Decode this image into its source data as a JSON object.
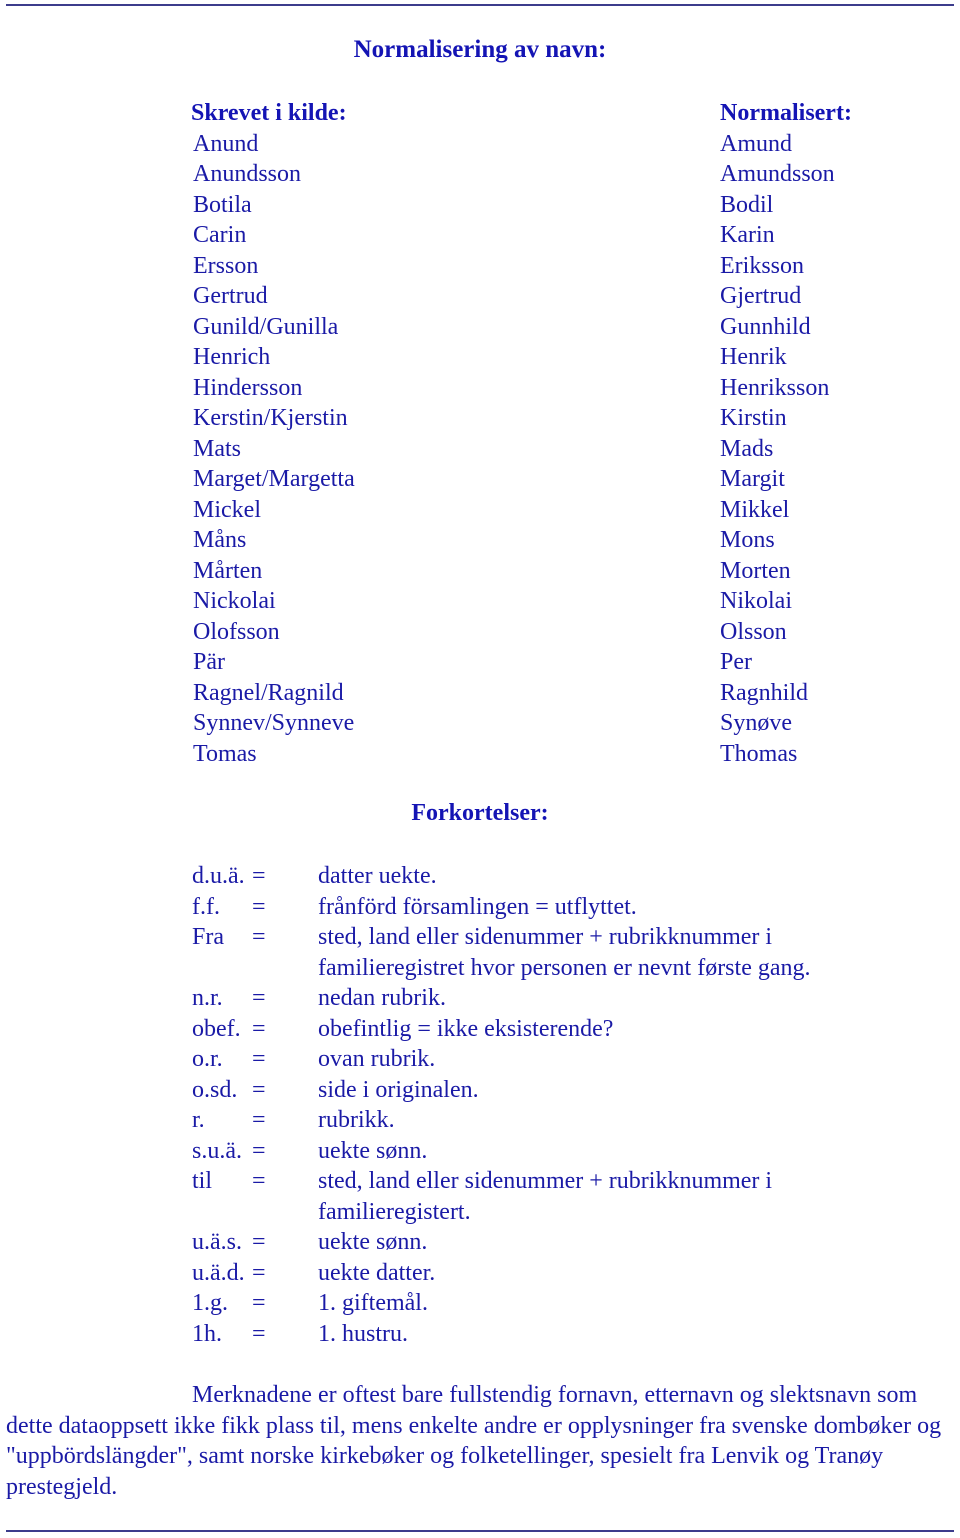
{
  "title": "Normalisering av navn:",
  "names": {
    "source_header": "Skrevet i kilde:",
    "normalized_header": "Normalisert:",
    "source": [
      "Anund",
      "Anundsson",
      "Botila",
      "Carin",
      "Ersson",
      "Gertrud",
      "Gunild/Gunilla",
      "Henrich",
      "Hindersson",
      "Kerstin/Kjerstin",
      "Mats",
      "Marget/Margetta",
      "Mickel",
      "Måns",
      "Mårten",
      "Nickolai",
      "Olofsson",
      "Pär",
      "Ragnel/Ragnild",
      "Synnev/Synneve",
      "Tomas"
    ],
    "normalized": [
      "Amund",
      "Amundsson",
      "Bodil",
      "Karin",
      "Eriksson",
      "Gjertrud",
      "Gunnhild",
      "Henrik",
      "Henriksson",
      "Kirstin",
      "Mads",
      "Margit",
      "Mikkel",
      "Mons",
      "Morten",
      "Nikolai",
      "Olsson",
      "Per",
      "Ragnhild",
      "Synøve",
      "Thomas"
    ]
  },
  "abbreviations": {
    "title": "Forkortelser:",
    "items": [
      {
        "key": "d.u.ä.",
        "eq": "=",
        "def": "datter uekte."
      },
      {
        "key": "f.f.",
        "eq": "=",
        "def": "frånförd församlingen = utflyttet."
      },
      {
        "key": "Fra",
        "eq": "=",
        "def": "sted, land eller sidenummer + rubrikknummer i familieregistret hvor personen er nevnt første gang."
      },
      {
        "key": "n.r.",
        "eq": "=",
        "def": "nedan rubrik."
      },
      {
        "key": "obef.",
        "eq": "=",
        "def": "obefintlig = ikke eksisterende?"
      },
      {
        "key": "o.r.",
        "eq": "=",
        "def": "ovan rubrik."
      },
      {
        "key": "o.sd.",
        "eq": "=",
        "def": "side i originalen."
      },
      {
        "key": "r.",
        "eq": "=",
        "def": "rubrikk."
      },
      {
        "key": "s.u.ä.",
        "eq": "=",
        "def": "uekte sønn."
      },
      {
        "key": "til",
        "eq": "=",
        "def": "sted, land eller sidenummer + rubrikknummer i familieregistert."
      },
      {
        "key": "u.ä.s.",
        "eq": "=",
        "def": "uekte sønn."
      },
      {
        "key": "u.ä.d.",
        "eq": "=",
        "def": "uekte datter."
      },
      {
        "key": "1.g.",
        "eq": "=",
        "def": "1. giftemål."
      },
      {
        "key": "1h.",
        "eq": "=",
        "def": "1. hustru."
      }
    ]
  },
  "note": "Merknadene er oftest bare fullstendig fornavn, etternavn og slektsnavn som dette dataoppsett ikke fikk plass til, mens enkelte andre er opplysninger fra svenske dombøker og \"uppbördslängder\", samt norske kirkebøker og folketellinger, spesielt fra Lenvik og Tranøy prestegjeld.",
  "colors": {
    "text": "#1a1aa6",
    "heading": "#1414b4",
    "rule": "#3c3c8c"
  }
}
